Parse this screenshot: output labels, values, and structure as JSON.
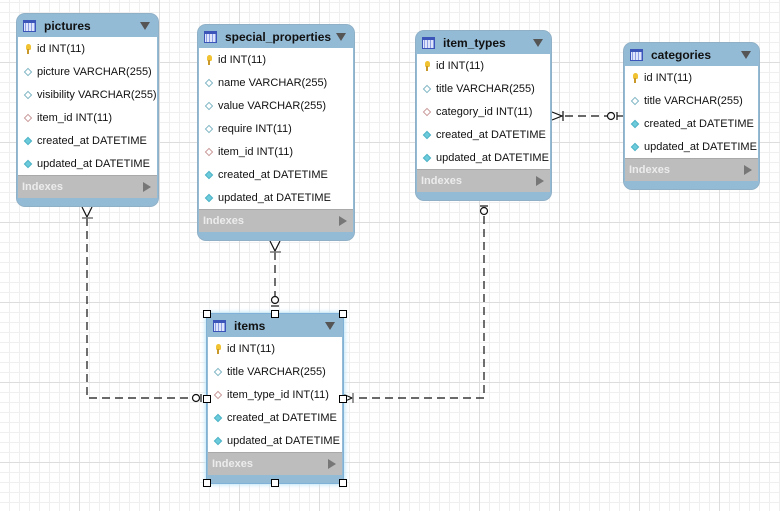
{
  "diagram": {
    "tables": [
      {
        "id": "pictures",
        "name": "pictures",
        "columns": [
          {
            "label": "id INT(11)",
            "kind": "primary-key"
          },
          {
            "label": "picture VARCHAR(255)",
            "kind": "column"
          },
          {
            "label": "visibility VARCHAR(255)",
            "kind": "column"
          },
          {
            "label": "item_id INT(11)",
            "kind": "foreign-key"
          },
          {
            "label": "created_at DATETIME",
            "kind": "not-null"
          },
          {
            "label": "updated_at DATETIME",
            "kind": "not-null"
          }
        ],
        "indexes_label": "Indexes"
      },
      {
        "id": "special_properties",
        "name": "special_properties",
        "columns": [
          {
            "label": "id INT(11)",
            "kind": "primary-key"
          },
          {
            "label": "name VARCHAR(255)",
            "kind": "column"
          },
          {
            "label": "value VARCHAR(255)",
            "kind": "column"
          },
          {
            "label": "require INT(11)",
            "kind": "column"
          },
          {
            "label": "item_id INT(11)",
            "kind": "foreign-key"
          },
          {
            "label": "created_at DATETIME",
            "kind": "not-null"
          },
          {
            "label": "updated_at DATETIME",
            "kind": "not-null"
          }
        ],
        "indexes_label": "Indexes"
      },
      {
        "id": "item_types",
        "name": "item_types",
        "columns": [
          {
            "label": "id INT(11)",
            "kind": "primary-key"
          },
          {
            "label": "title VARCHAR(255)",
            "kind": "column"
          },
          {
            "label": "category_id INT(11)",
            "kind": "foreign-key"
          },
          {
            "label": "created_at DATETIME",
            "kind": "not-null"
          },
          {
            "label": "updated_at DATETIME",
            "kind": "not-null"
          }
        ],
        "indexes_label": "Indexes"
      },
      {
        "id": "categories",
        "name": "categories",
        "columns": [
          {
            "label": "id INT(11)",
            "kind": "primary-key"
          },
          {
            "label": "title VARCHAR(255)",
            "kind": "column"
          },
          {
            "label": "created_at DATETIME",
            "kind": "not-null"
          },
          {
            "label": "updated_at DATETIME",
            "kind": "not-null"
          }
        ],
        "indexes_label": "Indexes"
      },
      {
        "id": "items",
        "name": "items",
        "selected": true,
        "columns": [
          {
            "label": "id INT(11)",
            "kind": "primary-key"
          },
          {
            "label": "title VARCHAR(255)",
            "kind": "column"
          },
          {
            "label": "item_type_id INT(11)",
            "kind": "foreign-key"
          },
          {
            "label": "created_at DATETIME",
            "kind": "not-null"
          },
          {
            "label": "updated_at DATETIME",
            "kind": "not-null"
          }
        ],
        "indexes_label": "Indexes"
      }
    ],
    "relationships": [
      {
        "from": "items",
        "to": "pictures",
        "type": "one-to-many",
        "identifying": false
      },
      {
        "from": "items",
        "to": "special_properties",
        "type": "one-to-many",
        "identifying": false
      },
      {
        "from": "item_types",
        "to": "items",
        "type": "one-to-many",
        "identifying": false
      },
      {
        "from": "categories",
        "to": "item_types",
        "type": "one-to-many",
        "identifying": false
      }
    ],
    "colors": {
      "header": "#94bbd6",
      "indexes_bar": "#bdbdbd",
      "primary_key": "#f1c232",
      "not_null": "#6ccbdb",
      "foreign_key": "#c99a9a"
    }
  }
}
